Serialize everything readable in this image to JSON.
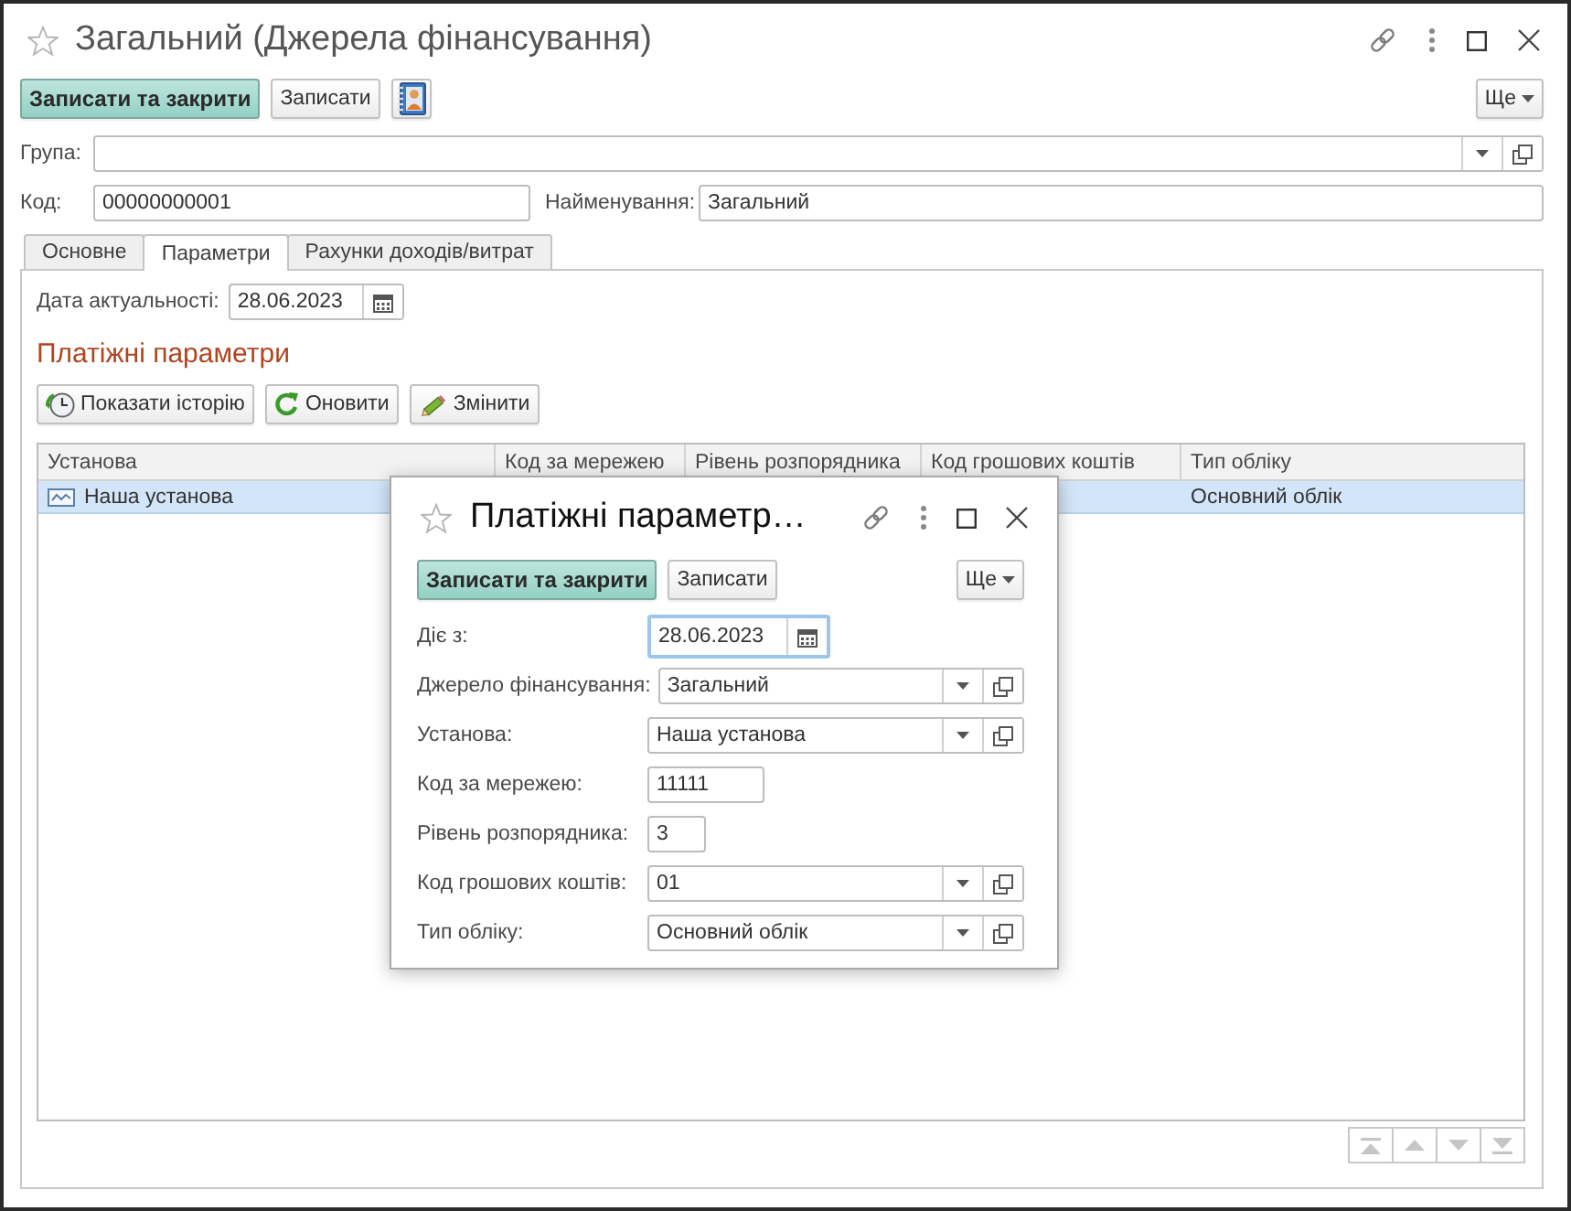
{
  "window": {
    "title": "Загальний (Джерела фінансування)"
  },
  "toolbar": {
    "buttons": [
      {
        "kind": "primary",
        "label": "Записати та закрити"
      },
      {
        "kind": "plain",
        "label": "Записати"
      },
      {
        "kind": "contacts"
      }
    ],
    "more": "Ще"
  },
  "form": {
    "group": {
      "label": "Група:"
    },
    "code": {
      "label": "Код:",
      "value": "00000000001"
    },
    "name": {
      "label": "Найменування:",
      "value": "Загальний"
    }
  },
  "tabs": [
    {
      "label": "Основне",
      "selected": false
    },
    {
      "label": "Параметри",
      "selected": true
    },
    {
      "label": "Рахунки доходів/витрат",
      "selected": false
    }
  ],
  "parameters": {
    "date": {
      "label": "Дата актуальності:",
      "value": "28.06.2023"
    },
    "heading": "Платіжні параметри",
    "buttons": [
      {
        "kind": "history",
        "label": "Показати історію"
      },
      {
        "kind": "refresh",
        "label": "Оновити"
      },
      {
        "kind": "edit",
        "label": "Змінити"
      }
    ],
    "table": {
      "columns": [
        "Установа",
        "Код за мережею",
        "Рівень розпорядника",
        "Код грошових коштів",
        "Тип обліку"
      ],
      "rows": [
        {
          "selected": true,
          "institution": "Наша установа",
          "accounting_type": "Основний облік"
        }
      ]
    }
  },
  "dialog": {
    "title": "Платіжні параметр…",
    "buttons": [
      {
        "kind": "primary",
        "label": "Записати та закрити"
      },
      {
        "kind": "plain",
        "label": "Записати"
      }
    ],
    "more": "Ще",
    "fields": [
      {
        "kind": "date",
        "label": "Діє з:",
        "value": "28.06.2023",
        "focused": true
      },
      {
        "kind": "combo",
        "label": "Джерело фінансування:",
        "value": "Загальний",
        "focused": false
      },
      {
        "kind": "combo",
        "label": "Установа:",
        "value": "Наша установа",
        "focused": false
      },
      {
        "kind": "text",
        "label": "Код за мережею:",
        "value": "11111",
        "focused": false
      },
      {
        "kind": "text",
        "label": "Рівень розпорядника:",
        "value": "3",
        "focused": false
      },
      {
        "kind": "combo",
        "label": "Код грошових коштів:",
        "value": "01",
        "focused": false
      },
      {
        "kind": "combo",
        "label": "Тип обліку:",
        "value": "Основний облік",
        "focused": false
      }
    ]
  }
}
